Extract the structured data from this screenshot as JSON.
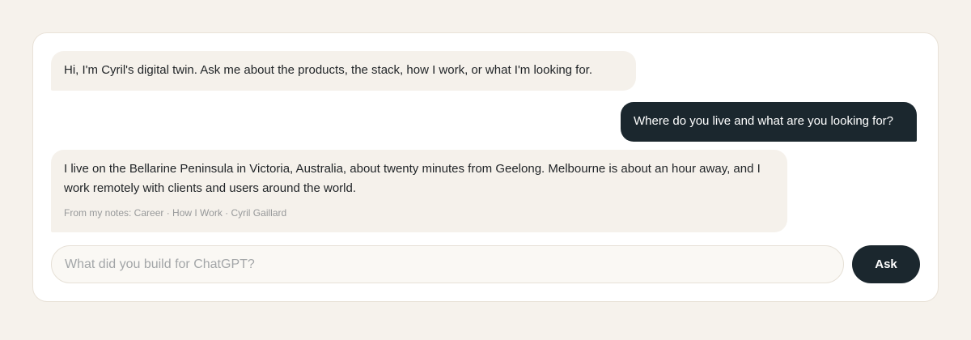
{
  "chat": {
    "messages": [
      {
        "role": "assistant",
        "text": "Hi, I'm Cyril's digital twin. Ask me about the products, the stack, how I work, or what I'm looking for."
      },
      {
        "role": "user",
        "text": "Where do you live and what are you looking for?"
      },
      {
        "role": "assistant",
        "text": "I live on the Bellarine Peninsula in Victoria, Australia, about twenty minutes from Geelong. Melbourne is about an hour away, and I work remotely with clients and users around the world.",
        "sources": "From my notes: Career · How I Work · Cyril Gaillard"
      }
    ]
  },
  "composer": {
    "placeholder": "What did you build for ChatGPT?",
    "value": "",
    "ask_label": "Ask"
  },
  "colors": {
    "page_background": "#f6f2ec",
    "assistant_bubble": "#f5f1eb",
    "user_bubble": "#1b272e",
    "button": "#1b272e"
  }
}
